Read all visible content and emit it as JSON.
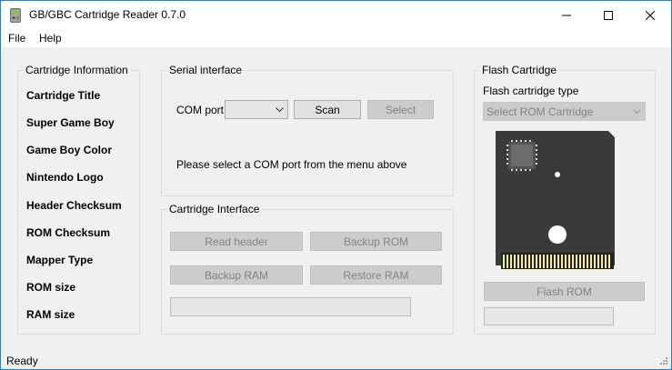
{
  "window": {
    "title": "GB/GBC Cartridge Reader 0.7.0",
    "accent_color": "#1883d7"
  },
  "menu": {
    "file": "File",
    "help": "Help"
  },
  "cartridge_info": {
    "title": "Cartridge Information",
    "fields": [
      "Cartridge Title",
      "Super Game Boy",
      "Game Boy Color",
      "Nintendo Logo",
      "Header Checksum",
      "ROM Checksum",
      "Mapper Type",
      "ROM size",
      "RAM size"
    ]
  },
  "serial": {
    "title": "Serial interface",
    "com_port_label": "COM port",
    "com_port_value": "",
    "scan_label": "Scan",
    "select_label": "Select",
    "message": "Please select a COM port from the menu above"
  },
  "cartridge_interface": {
    "title": "Cartridge Interface",
    "read_header": "Read header",
    "backup_rom": "Backup ROM",
    "backup_ram": "Backup RAM",
    "restore_ram": "Restore RAM",
    "progress": 0
  },
  "flash": {
    "title": "Flash Cartridge",
    "type_label": "Flash cartridge type",
    "type_value": "Select ROM Cartridge",
    "flash_rom_label": "Flash ROM",
    "progress": 0
  },
  "status": {
    "text": "Ready"
  }
}
